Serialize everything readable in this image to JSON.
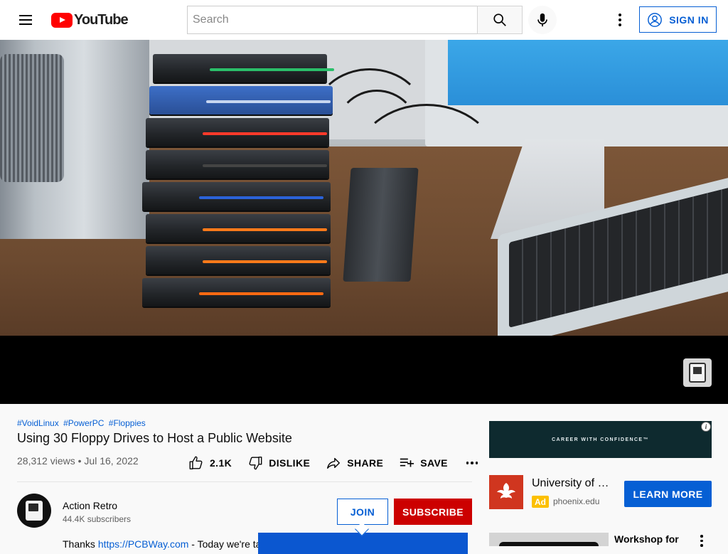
{
  "masthead": {
    "logo_text": "YouTube",
    "search_placeholder": "Search",
    "sign_in_label": "SIGN IN"
  },
  "video": {
    "hashtags": [
      "#VoidLinux",
      "#PowerPC",
      "#Floppies"
    ],
    "title": "Using 30 Floppy Drives to Host a Public Website",
    "views": "28,312 views",
    "date": "Jul 16, 2022",
    "separator": "•",
    "actions": {
      "like_count": "2.1K",
      "dislike_label": "DISLIKE",
      "share_label": "SHARE",
      "save_label": "SAVE"
    }
  },
  "channel": {
    "name": "Action Retro",
    "subscribers": "44.4K subscribers",
    "join_label": "JOIN",
    "subscribe_label": "SUBSCRIBE"
  },
  "description": {
    "prefix": "Thanks ",
    "link": "https://PCBWay.com",
    "suffix": " - Today we're ta"
  },
  "sidebar": {
    "banner_text": "CAREER WITH CONFIDENCE™",
    "ad_info": "i",
    "ad_title": "University of Phoenix",
    "ad_badge": "Ad",
    "ad_domain": "phoenix.edu",
    "ad_cta": "LEARN MORE",
    "next_title": "Workshop for"
  },
  "colors": {
    "brand_red": "#ff0000",
    "link_blue": "#065fd4",
    "subscribe_red": "#cc0000",
    "ad_yellow": "#fcc000"
  },
  "icons": [
    "menu-icon",
    "youtube-logo-icon",
    "search-icon",
    "mic-icon",
    "more-vert-icon",
    "account-icon",
    "like-icon",
    "dislike-icon",
    "share-icon",
    "playlist-add-icon",
    "more-horiz-icon",
    "info-icon",
    "phoenix-logo-icon",
    "cursor-icon"
  ]
}
